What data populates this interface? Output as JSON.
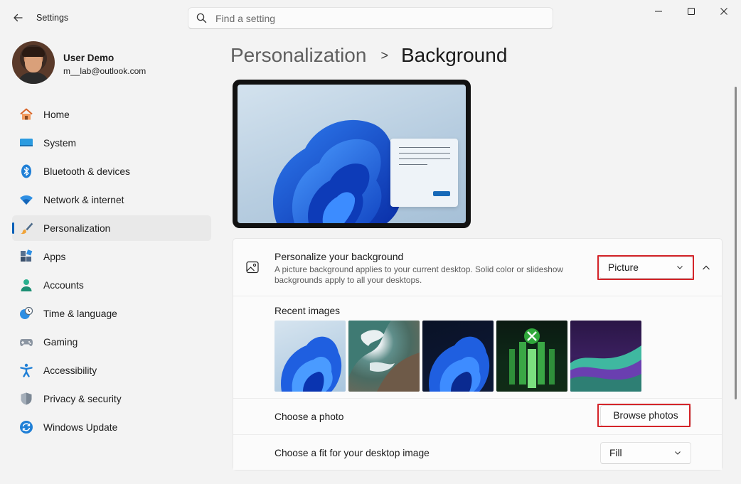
{
  "window": {
    "app_title": "Settings",
    "controls": [
      "minimize",
      "maximize",
      "close"
    ]
  },
  "search": {
    "placeholder": "Find a setting"
  },
  "profile": {
    "name": "User Demo",
    "email": "m__lab@outlook.com"
  },
  "sidebar": {
    "items": [
      {
        "label": "Home",
        "icon": "home-icon"
      },
      {
        "label": "System",
        "icon": "system-icon"
      },
      {
        "label": "Bluetooth & devices",
        "icon": "bluetooth-icon"
      },
      {
        "label": "Network & internet",
        "icon": "wifi-icon"
      },
      {
        "label": "Personalization",
        "icon": "brush-icon",
        "selected": true
      },
      {
        "label": "Apps",
        "icon": "apps-icon"
      },
      {
        "label": "Accounts",
        "icon": "accounts-icon"
      },
      {
        "label": "Time & language",
        "icon": "clock-globe-icon"
      },
      {
        "label": "Gaming",
        "icon": "gamepad-icon"
      },
      {
        "label": "Accessibility",
        "icon": "accessibility-icon"
      },
      {
        "label": "Privacy & security",
        "icon": "shield-icon"
      },
      {
        "label": "Windows Update",
        "icon": "update-icon"
      }
    ]
  },
  "breadcrumb": {
    "parent": "Personalization",
    "separator": ">",
    "current": "Background"
  },
  "background": {
    "title": "Personalize your background",
    "description": "A picture background applies to your current desktop. Solid color or slideshow backgrounds apply to all your desktops.",
    "type_value": "Picture",
    "recent_label": "Recent images",
    "recent_images": [
      "bloom-light",
      "aerial-coast",
      "bloom-dark",
      "xbox-green",
      "purple-waves"
    ],
    "choose_photo_label": "Choose a photo",
    "browse_label": "Browse photos",
    "fit_label": "Choose a fit for your desktop image",
    "fit_value": "Fill"
  },
  "colors": {
    "accent": "#005fb8",
    "highlight_box": "#d42429",
    "window_bg": "#f3f3f3",
    "card_bg": "#fbfbfb"
  }
}
